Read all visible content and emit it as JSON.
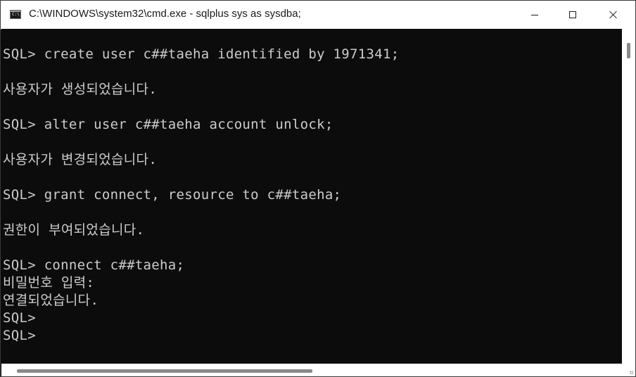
{
  "window": {
    "title": "C:\\WINDOWS\\system32\\cmd.exe - sqlplus  sys as sysdba;",
    "icon_label": "C:\\"
  },
  "controls": {
    "minimize": "minimize-icon",
    "maximize": "maximize-icon",
    "close": "close-icon"
  },
  "console": {
    "lines": [
      "SQL> create user c##taeha identified by 1971341;",
      "사용자가 생성되었습니다.",
      "SQL> alter user c##taeha account unlock;",
      "사용자가 변경되었습니다.",
      "SQL> grant connect, resource to c##taeha;",
      "권한이 부여되었습니다.",
      "SQL> connect c##taeha;",
      "비밀번호 입력:",
      "연결되었습니다.",
      "SQL>",
      "SQL>"
    ]
  },
  "colors": {
    "console_bg": "#0c0c0c",
    "console_text": "#cccccc",
    "titlebar_bg": "#ffffff"
  }
}
